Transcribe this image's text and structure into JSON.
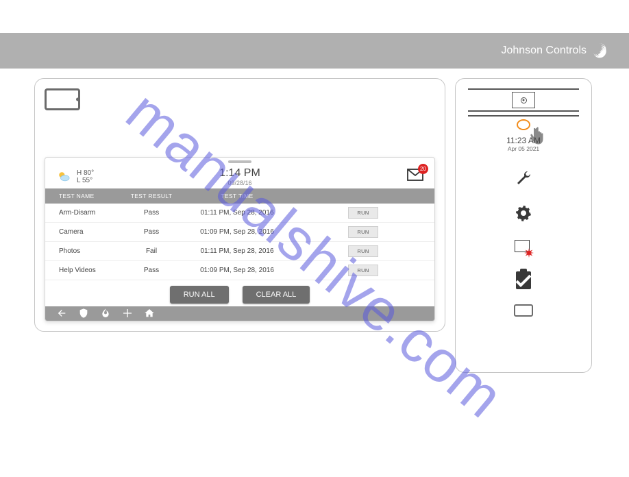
{
  "brand": {
    "name": "Johnson Controls"
  },
  "watermark": "manualshive.com",
  "main": {
    "status": {
      "weather": {
        "high_label": "H 80°",
        "low_label": "L 55°"
      },
      "clock": {
        "time": "1:14 PM",
        "date": "09/28/16"
      },
      "mail_badge": "20"
    },
    "table": {
      "headers": {
        "name": "TEST NAME",
        "result": "TEST RESULT",
        "time": "TEST TIME",
        "run": ""
      },
      "rows": [
        {
          "name": "Arm-Disarm",
          "result": "Pass",
          "time": "01:11 PM, Sep 28, 2016",
          "btn": "RUN"
        },
        {
          "name": "Camera",
          "result": "Pass",
          "time": "01:09 PM, Sep 28, 2016",
          "btn": "RUN"
        },
        {
          "name": "Photos",
          "result": "Fail",
          "time": "01:11 PM, Sep 28, 2016",
          "btn": "RUN"
        },
        {
          "name": "Help Videos",
          "result": "Pass",
          "time": "01:09 PM, Sep 28, 2016",
          "btn": "RUN"
        }
      ]
    },
    "actions": {
      "run_all": "RUN ALL",
      "clear_all": "CLEAR ALL"
    }
  },
  "side": {
    "clock": {
      "time": "11:23 AM",
      "date": "Apr 05 2021"
    }
  }
}
